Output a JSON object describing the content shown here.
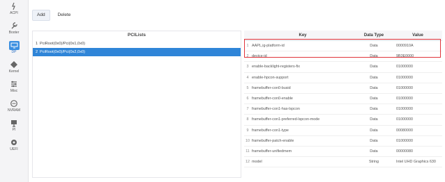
{
  "sidebar": {
    "items": [
      {
        "label": "ACPI",
        "icon": "power-plug-icon"
      },
      {
        "label": "Booter",
        "icon": "wrench-icon"
      },
      {
        "label": "DP",
        "icon": "monitor-icon",
        "active": true
      },
      {
        "label": "Kernel",
        "icon": "gear-cube-icon"
      },
      {
        "label": "Misc",
        "icon": "settings-icon"
      },
      {
        "label": "NVRAM",
        "icon": "nvram-icon"
      },
      {
        "label": "PI",
        "icon": "platform-icon"
      },
      {
        "label": "UEFI",
        "icon": "uefi-gear-icon"
      }
    ],
    "active_color": "#3b8fe0"
  },
  "toolbar": {
    "add_label": "Add",
    "delete_label": "Delete"
  },
  "pci_panel": {
    "title": "PCILists",
    "rows": [
      {
        "index": "1",
        "path": "PciRoot(0x0)/Pci(0x1,0x0)"
      },
      {
        "index": "2",
        "path": "PciRoot(0x0)/Pci(0x2,0x0)",
        "selected": true
      }
    ],
    "selected_color": "#2f85d8"
  },
  "props_table": {
    "headers": {
      "key": "Key",
      "type": "Data Type",
      "value": "Value"
    },
    "rows": [
      {
        "n": "1",
        "key": "AAPL,ig-platform-id",
        "type": "Data",
        "value": "0000910A"
      },
      {
        "n": "2",
        "key": "device-id",
        "type": "Data",
        "value": "9B3E0000"
      },
      {
        "n": "3",
        "key": "enable-backlight-registers-fix",
        "type": "Data",
        "value": "01000000"
      },
      {
        "n": "4",
        "key": "enable-hpcon-support",
        "type": "Data",
        "value": "01000000"
      },
      {
        "n": "5",
        "key": "framebuffer-con0-busid",
        "type": "Data",
        "value": "01000000"
      },
      {
        "n": "6",
        "key": "framebuffer-con0-enable",
        "type": "Data",
        "value": "01000000"
      },
      {
        "n": "7",
        "key": "framebuffer-con1-has-lspcon",
        "type": "Data",
        "value": "01000000"
      },
      {
        "n": "8",
        "key": "framebuffer-con1-preferred-lspcon-mode",
        "type": "Data",
        "value": "01000000"
      },
      {
        "n": "9",
        "key": "framebuffer-con1-type",
        "type": "Data",
        "value": "00080000"
      },
      {
        "n": "10",
        "key": "framebuffer-patch-enable",
        "type": "Data",
        "value": "01000000"
      },
      {
        "n": "11",
        "key": "framebuffer-unifiedmem",
        "type": "Data",
        "value": "00000080"
      },
      {
        "n": "12",
        "key": "model",
        "type": "String",
        "value": "Intel UHD Graphics 630"
      }
    ],
    "highlight_color": "#e0333a"
  }
}
